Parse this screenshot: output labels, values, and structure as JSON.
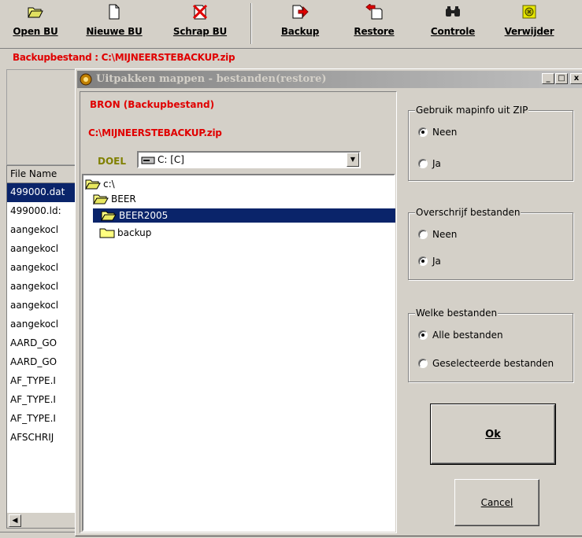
{
  "toolbar": {
    "buttons": [
      {
        "label": "Open BU",
        "icon": "folder-open-icon"
      },
      {
        "label": "Nieuwe BU",
        "icon": "new-document-icon"
      },
      {
        "label": "Schrap BU",
        "icon": "delete-x-icon"
      },
      {
        "label": "Backup",
        "icon": "backup-arrow-icon"
      },
      {
        "label": "Restore",
        "icon": "restore-arrow-icon"
      },
      {
        "label": "Controle",
        "icon": "binoculars-icon"
      },
      {
        "label": "Verwijder",
        "icon": "remove-icon"
      }
    ]
  },
  "backup_file_line": "Backupbestand : C:\\MIJNEERSTEBACKUP.zip",
  "file_list": {
    "header": "File Name",
    "rows": [
      "499000.dat",
      "499000.ld:",
      "aangekocl",
      "aangekocl",
      "aangekocl",
      "aangekocl",
      "aangekocl",
      "aangekocl",
      "AARD_GO",
      "AARD_GO",
      "AF_TYPE.I",
      "AF_TYPE.I",
      "AF_TYPE.I",
      "AFSCHRIJ"
    ],
    "selected_index": 0,
    "scroll_left_glyph": "◀"
  },
  "dialog": {
    "title": "Uitpakken mappen - bestanden(restore)",
    "caption_buttons": {
      "minimize": "_",
      "maximize": "□",
      "close": "x"
    },
    "source_label": "BRON  (Backupbestand)",
    "source_path": "C:\\MIJNEERSTEBACKUP.zip",
    "target_label": "DOEL",
    "drive_value": "C: [C]",
    "drive_dropdown_glyph": "▼",
    "tree": [
      "c:\\",
      "BEER",
      "BEER2005",
      "backup"
    ],
    "tree_selected": 2,
    "group_mapinfo": {
      "title": "Gebruik mapinfo uit ZIP",
      "options": [
        "Neen",
        "Ja"
      ],
      "selected": 0
    },
    "group_overwrite": {
      "title": "Overschrijf bestanden",
      "options": [
        "Neen",
        "Ja"
      ],
      "selected": 1
    },
    "group_which": {
      "title": "Welke bestanden",
      "options": [
        "Alle bestanden",
        "Geselecteerde bestanden"
      ],
      "selected": 0
    },
    "ok_label": "Ok",
    "cancel_label": "Cancel"
  },
  "colors": {
    "accent_red": "#e00000",
    "selection": "#0a246a",
    "face": "#d4d0c8",
    "doel_olive": "#808000"
  }
}
